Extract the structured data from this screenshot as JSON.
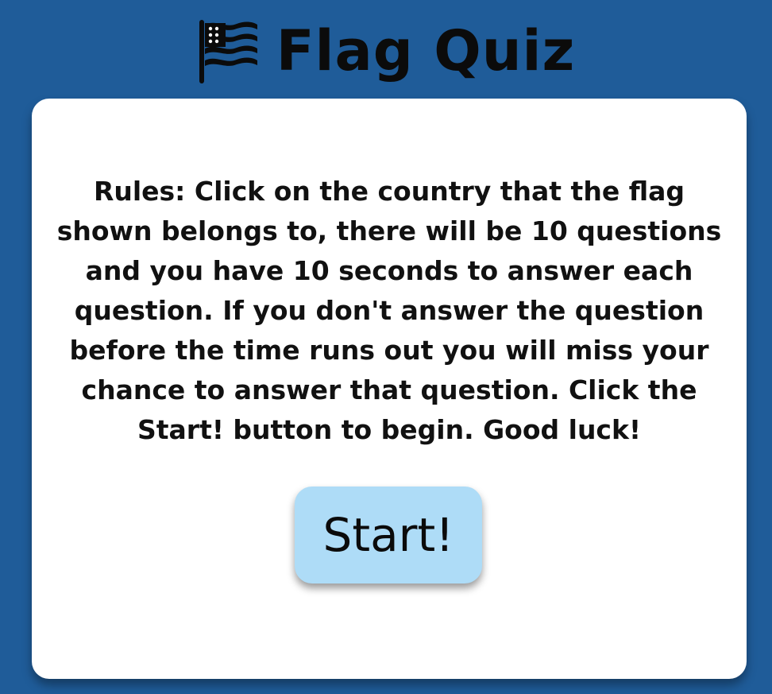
{
  "header": {
    "icon": "waving-flag-icon",
    "title": "Flag Quiz"
  },
  "card": {
    "rules": "Rules: Click on the country that the flag shown belongs to, there will be 10 questions and you have 10 seconds to answer each question. If you don't answer the question before the time runs out you will miss your chance to answer that question. Click the Start! button to begin. Good luck!",
    "start_label": "Start!"
  },
  "colors": {
    "background": "#1f5c99",
    "card": "#ffffff",
    "button": "#aedcf7",
    "text": "#111111"
  }
}
